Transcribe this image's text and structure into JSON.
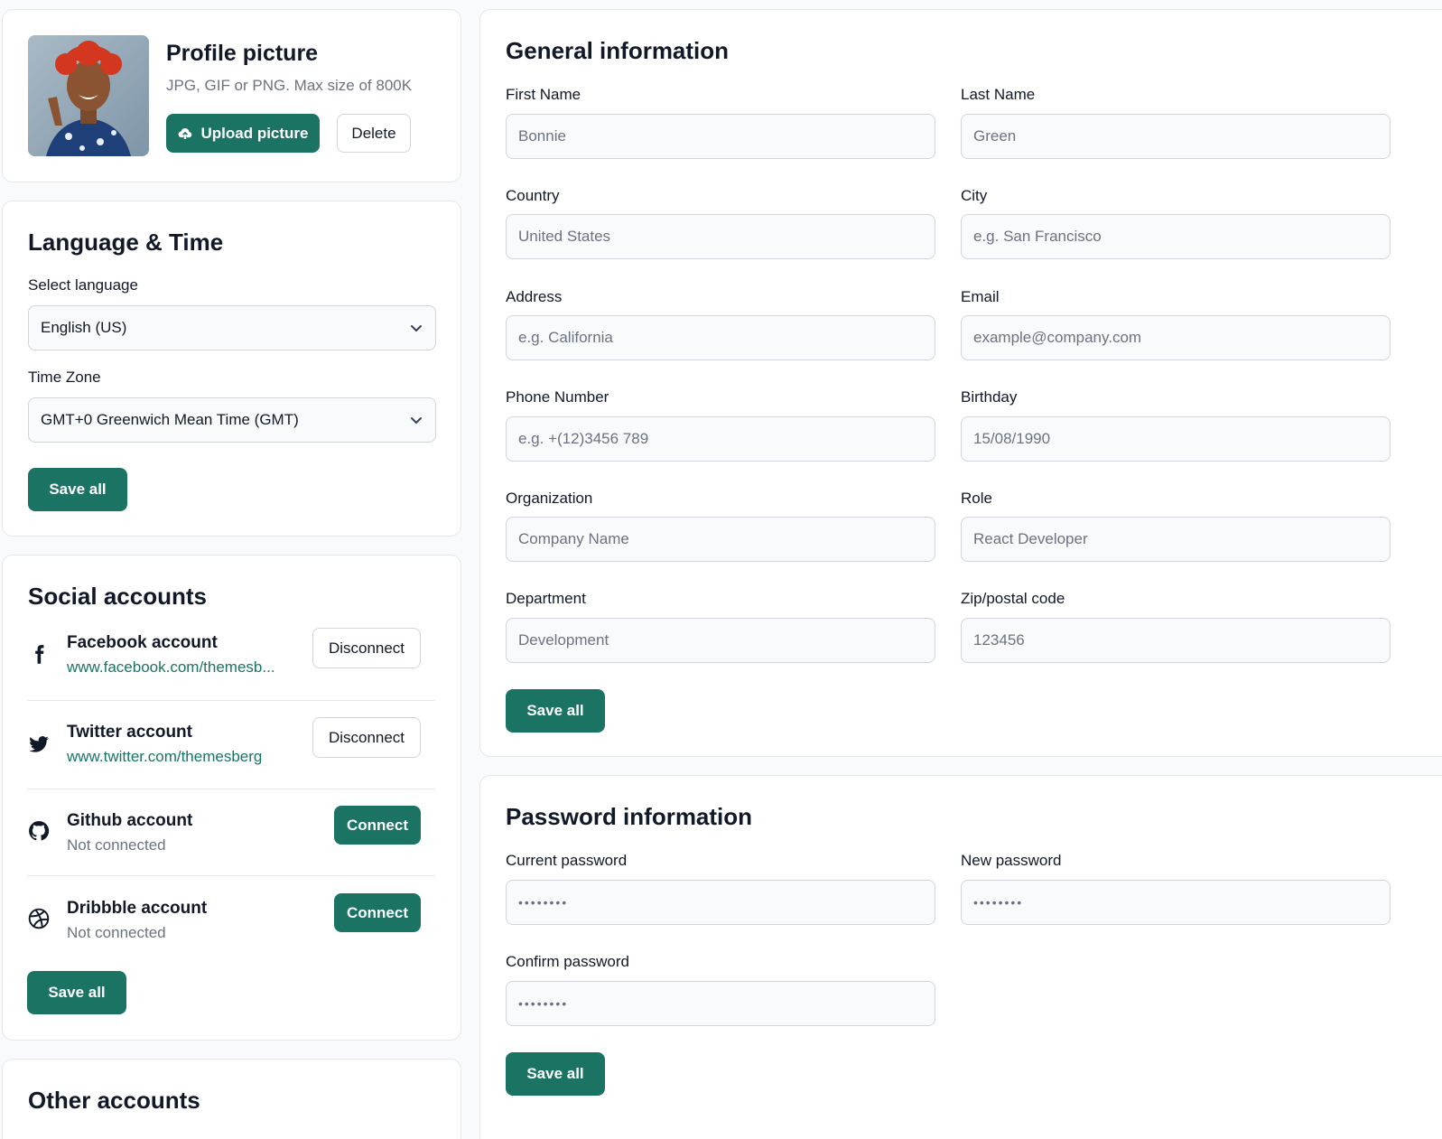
{
  "profile": {
    "title": "Profile picture",
    "subtitle": "JPG, GIF or PNG. Max size of 800K",
    "upload_label": "Upload picture",
    "delete_label": "Delete"
  },
  "language_time": {
    "title": "Language & Time",
    "language_label": "Select language",
    "language_value": "English (US)",
    "timezone_label": "Time Zone",
    "timezone_value": "GMT+0 Greenwich Mean Time (GMT)",
    "save_label": "Save all"
  },
  "social": {
    "title": "Social accounts",
    "items": [
      {
        "title": "Facebook account",
        "sub": "www.facebook.com/themesb...",
        "action": "Disconnect",
        "icon": "facebook-icon"
      },
      {
        "title": "Twitter account",
        "sub": "www.twitter.com/themesberg",
        "action": "Disconnect",
        "icon": "twitter-icon"
      },
      {
        "title": "Github account",
        "sub": "Not connected",
        "action": "Connect",
        "icon": "github-icon"
      },
      {
        "title": "Dribbble account",
        "sub": "Not connected",
        "action": "Connect",
        "icon": "dribbble-icon"
      }
    ],
    "save_label": "Save all"
  },
  "other": {
    "title": "Other accounts"
  },
  "general": {
    "title": "General information",
    "fields": {
      "first_name": {
        "label": "First Name",
        "placeholder": "Bonnie"
      },
      "last_name": {
        "label": "Last Name",
        "placeholder": "Green"
      },
      "country": {
        "label": "Country",
        "placeholder": "United States"
      },
      "city": {
        "label": "City",
        "placeholder": "e.g. San Francisco"
      },
      "address": {
        "label": "Address",
        "placeholder": "e.g. California"
      },
      "email": {
        "label": "Email",
        "placeholder": "example@company.com"
      },
      "phone": {
        "label": "Phone Number",
        "placeholder": "e.g. +(12)3456 789"
      },
      "birthday": {
        "label": "Birthday",
        "placeholder": "15/08/1990"
      },
      "organization": {
        "label": "Organization",
        "placeholder": "Company Name"
      },
      "role": {
        "label": "Role",
        "placeholder": "React Developer"
      },
      "department": {
        "label": "Department",
        "placeholder": "Development"
      },
      "zip": {
        "label": "Zip/postal code",
        "placeholder": "123456"
      }
    },
    "save_label": "Save all"
  },
  "password": {
    "title": "Password information",
    "current_label": "Current password",
    "current_value": "••••••••",
    "new_label": "New password",
    "new_value": "••••••••",
    "confirm_label": "Confirm password",
    "confirm_value": "••••••••",
    "save_label": "Save all"
  },
  "colors": {
    "accent": "#1a7363",
    "border": "#d1d5db",
    "background": "#f9fafb"
  }
}
